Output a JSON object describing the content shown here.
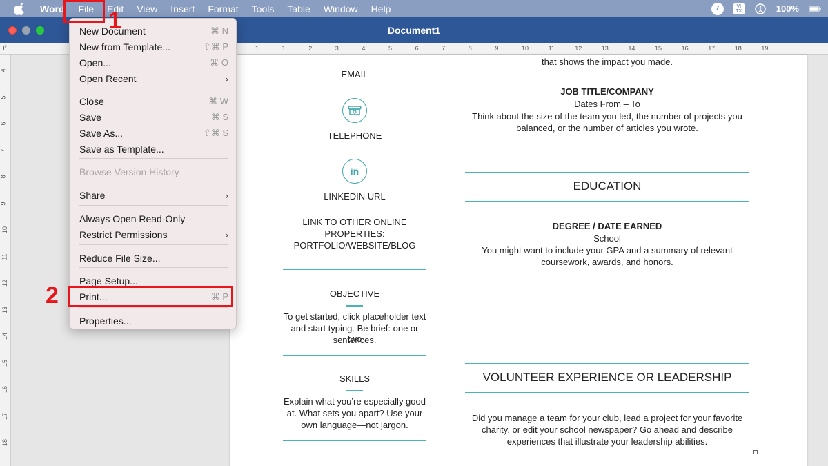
{
  "menubar": {
    "app_name": "Word",
    "items": [
      "File",
      "Edit",
      "View",
      "Insert",
      "Format",
      "Tools",
      "Table",
      "Window",
      "Help"
    ],
    "battery": "100%",
    "status_badge": "7",
    "input_source": "VI TX"
  },
  "window": {
    "title": "Document1"
  },
  "ruler": {
    "numbers": [
      "1",
      "1",
      "2",
      "3",
      "4",
      "5",
      "6",
      "7",
      "8",
      "9",
      "10",
      "11",
      "12",
      "13",
      "14",
      "15",
      "16",
      "17",
      "18",
      "19"
    ]
  },
  "vruler": {
    "numbers": [
      "4",
      "5",
      "6",
      "7",
      "8",
      "9",
      "10",
      "11",
      "12",
      "13",
      "14",
      "15",
      "16",
      "17",
      "18"
    ]
  },
  "file_menu": {
    "items": [
      {
        "label": "New Document",
        "shortcut": "⌘ N"
      },
      {
        "label": "New from Template...",
        "shortcut": "⇧⌘ P"
      },
      {
        "label": "Open...",
        "shortcut": "⌘ O"
      },
      {
        "label": "Open Recent",
        "shortcut": "›"
      },
      {
        "label": "Close",
        "shortcut": "⌘ W"
      },
      {
        "label": "Save",
        "shortcut": "⌘ S"
      },
      {
        "label": "Save As...",
        "shortcut": "⇧⌘ S"
      },
      {
        "label": "Save as Template...",
        "shortcut": ""
      },
      {
        "label": "Browse Version History",
        "shortcut": ""
      },
      {
        "label": "Share",
        "shortcut": "›"
      },
      {
        "label": "Always Open Read-Only",
        "shortcut": ""
      },
      {
        "label": "Restrict Permissions",
        "shortcut": "›"
      },
      {
        "label": "Reduce File Size...",
        "shortcut": ""
      },
      {
        "label": "Page Setup...",
        "shortcut": ""
      },
      {
        "label": "Print...",
        "shortcut": "⌘ P"
      },
      {
        "label": "Properties...",
        "shortcut": ""
      }
    ]
  },
  "annotations": {
    "step1": "1",
    "step2": "2"
  },
  "document": {
    "left": {
      "email": "EMAIL",
      "telephone": "TELEPHONE",
      "linkedin": "LINKEDIN URL",
      "linkedin_icon": "in",
      "other_line1": "LINK TO OTHER ONLINE",
      "other_line2": "PROPERTIES:",
      "other_line3": "PORTFOLIO/WEBSITE/BLOG",
      "objective_title": "OBJECTIVE",
      "objective_line1": "To get started, click placeholder text",
      "objective_line2": "and start typing. Be brief: one or two",
      "objective_line3": "sentences.",
      "skills_title": "SKILLS",
      "skills_line1": "Explain what you’re especially good",
      "skills_line2": "at. What sets you apart? Use your",
      "skills_line3": "own language—not jargon."
    },
    "right": {
      "impact_line": "that shows the impact you made.",
      "job_title": "JOB TITLE/COMPANY",
      "dates": "Dates From – To",
      "job_line1": "Think about the size of the team you led, the number of projects you",
      "job_line2": "balanced, or the number of articles you wrote.",
      "education_heading": "EDUCATION",
      "degree": "DEGREE / DATE EARNED",
      "school": "School",
      "edu_line1": "You might want to include your GPA and a summary of relevant",
      "edu_line2": "coursework, awards, and honors.",
      "volunteer_heading": "VOLUNTEER EXPERIENCE OR LEADERSHIP",
      "vol_line1": "Did you manage a team for your club, lead a project for your favorite",
      "vol_line2": "charity, or edit your school newspaper? Go ahead and describe",
      "vol_line3": "experiences that illustrate your leadership abilities."
    }
  },
  "colors": {
    "menubar": "#8a9ec2",
    "titlebar": "#2e5797",
    "accent_teal": "#4ab4b4",
    "annotation_red": "#e8161b"
  }
}
